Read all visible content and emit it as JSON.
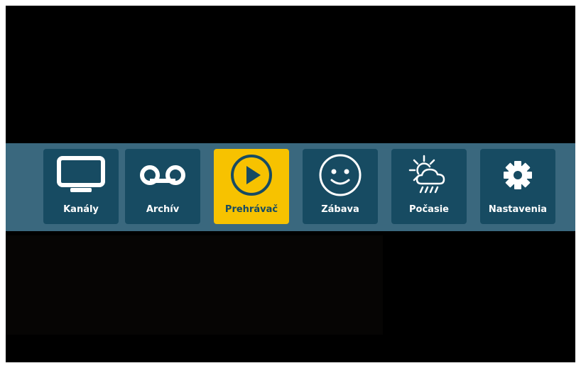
{
  "menu": {
    "active_index": 2,
    "items": [
      {
        "label": "Kanály",
        "icon": "tv-icon"
      },
      {
        "label": "Archív",
        "icon": "voicemail-icon"
      },
      {
        "label": "Prehrávač",
        "icon": "play-circle-icon"
      },
      {
        "label": "Zábava",
        "icon": "smiley-icon"
      },
      {
        "label": "Počasie",
        "icon": "weather-sun-rain-icon"
      },
      {
        "label": "Nastavenia",
        "icon": "gear-icon"
      }
    ]
  },
  "colors": {
    "bar": "#3a687e",
    "tile": "#174b62",
    "active_tile": "#f7c200",
    "icon_light": "#ffffff",
    "icon_dark": "#174b62"
  }
}
